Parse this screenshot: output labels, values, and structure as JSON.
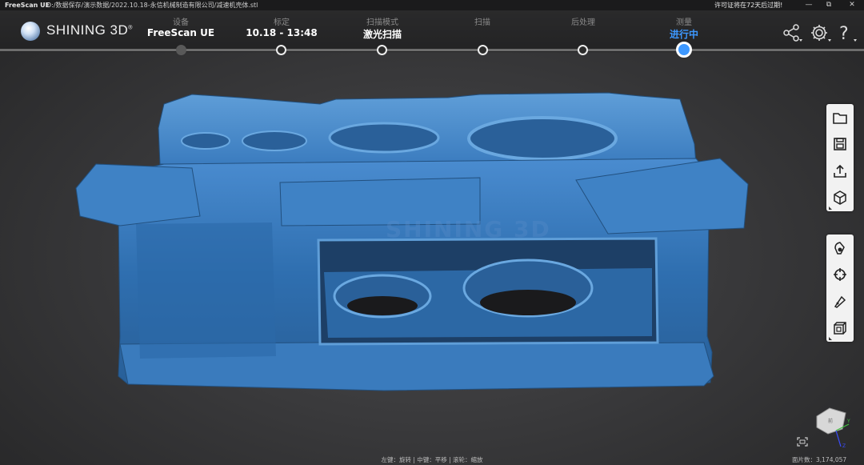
{
  "titlebar": {
    "app_name": "FreeScan UE",
    "file_path": "D:/数据保存/演示数据/2022.10.18-永信机械制造有限公司/减速机壳体.stl",
    "license_text": "许可证将在72天后过期!",
    "minimize": "—",
    "maximize": "⧉",
    "close": "✕"
  },
  "brand": {
    "name": "SHINING 3D",
    "reg": "®"
  },
  "workflow": [
    {
      "name": "设备",
      "value": "FreeScan UE",
      "state": "done"
    },
    {
      "name": "标定",
      "value": "10.18 - 13:48",
      "state": "pending"
    },
    {
      "name": "扫描模式",
      "value": "激光扫描",
      "state": "pending"
    },
    {
      "name": "扫描",
      "value": "",
      "state": "pending"
    },
    {
      "name": "后处理",
      "value": "",
      "state": "pending"
    },
    {
      "name": "测量",
      "value": "进行中",
      "state": "current"
    }
  ],
  "header_icons": [
    "share-icon",
    "settings-icon",
    "help-icon"
  ],
  "watermark": "SHINING 3D",
  "toolbar_top": [
    "open-folder-icon",
    "save-icon",
    "export-icon",
    "view-cube-icon"
  ],
  "toolbar_bottom": [
    "select-icon",
    "target-icon",
    "marker-icon",
    "3d-box-icon"
  ],
  "colors": {
    "accent": "#3d98ff",
    "model": "#2f6fb0",
    "background": "#3a3a3c"
  },
  "status": {
    "mouse_hint": "左键：旋转 | 中键：平移 | 滚轮：缩放",
    "face_count": "面片数：3,174,057"
  },
  "view_cube": {
    "face_label": "前",
    "axis_y": "Y",
    "axis_z": "Z"
  }
}
